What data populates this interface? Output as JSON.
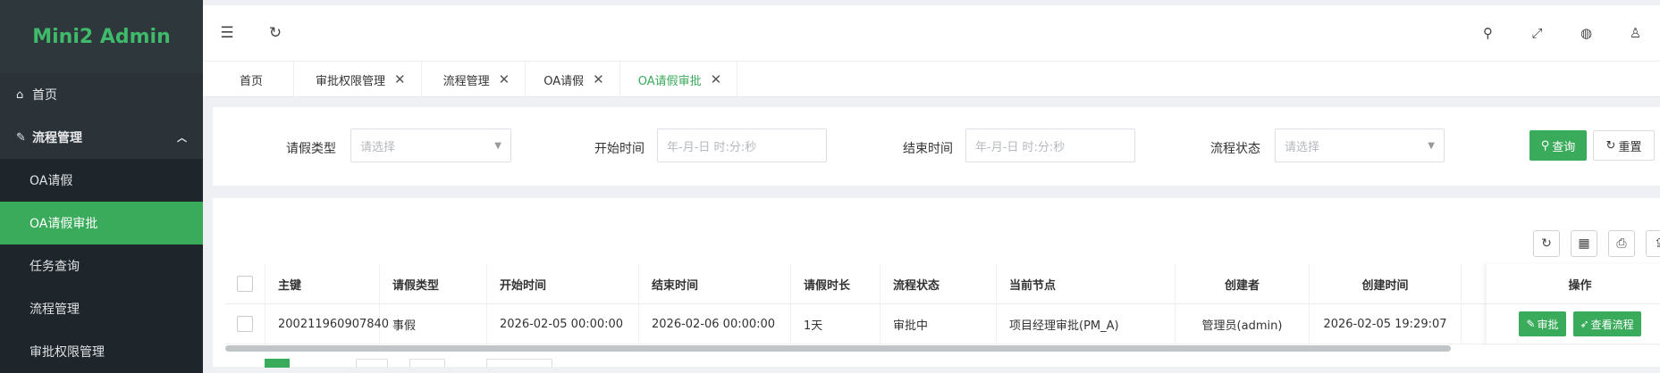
{
  "app": {
    "brand": "Mini2 Admin",
    "accent": "#3aaa5b"
  },
  "sidebar": {
    "home": "首页",
    "group": "流程管理",
    "items": [
      "OA请假",
      "OA请假审批",
      "任务查询",
      "流程管理",
      "审批权限管理"
    ]
  },
  "tabs": [
    {
      "label": "首页"
    },
    {
      "label": "审批权限管理"
    },
    {
      "label": "流程管理"
    },
    {
      "label": "OA请假"
    },
    {
      "label": "OA请假审批"
    }
  ],
  "filter": {
    "leave_type_label": "请假类型",
    "leave_type_placeholder": "请选择",
    "start_label": "开始时间",
    "start_placeholder": "年-月-日 时:分:秒",
    "end_label": "结束时间",
    "end_placeholder": "年-月-日 时:分:秒",
    "status_label": "流程状态",
    "status_placeholder": "请选择",
    "query": "查询",
    "reset": "重置"
  },
  "table": {
    "columns": [
      "主键",
      "请假类型",
      "开始时间",
      "结束时间",
      "请假时长",
      "流程状态",
      "当前节点",
      "创建者",
      "创建时间",
      "操作"
    ],
    "rows": [
      [
        "200211960907840",
        "事假",
        "2026-02-05 00:00:00",
        "2026-02-06 00:00:00",
        "1天",
        "审批中",
        "项目经理审批(PM_A)",
        "管理员(admin)",
        "2026-02-05 19:29:07"
      ]
    ],
    "actions": [
      "审批",
      "查看流程"
    ]
  },
  "icons": [
    "menu-fold-icon",
    "refresh-icon",
    "search-icon",
    "fullscreen-icon",
    "globe-icon",
    "user-icon"
  ]
}
